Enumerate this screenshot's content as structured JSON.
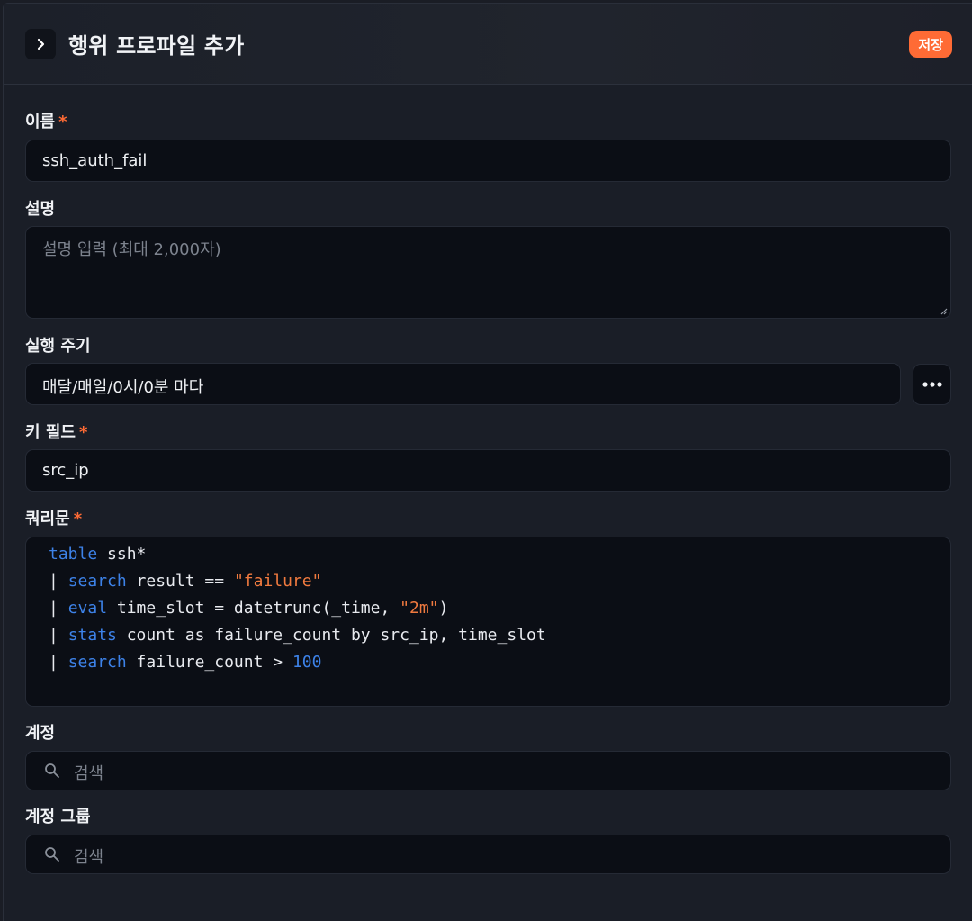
{
  "header": {
    "title": "행위 프로파일 추가",
    "save_label": "저장",
    "accent_color": "#ff6b35"
  },
  "form": {
    "name": {
      "label": "이름",
      "required_mark": "*",
      "value": "ssh_auth_fail"
    },
    "description": {
      "label": "설명",
      "placeholder": "설명 입력 (최대 2,000자)"
    },
    "schedule": {
      "label": "실행 주기",
      "value": "매달/매일/0시/0분 마다",
      "more_icon": "more-horizontal-icon"
    },
    "key_field": {
      "label": "키 필드",
      "required_mark": "*",
      "value": "src_ip"
    },
    "query": {
      "label": "쿼리문",
      "required_mark": "*",
      "lines": [
        [
          {
            "t": "table",
            "c": "kw"
          },
          {
            "t": " ssh*",
            "c": ""
          }
        ],
        [
          {
            "t": "| ",
            "c": ""
          },
          {
            "t": "search",
            "c": "kw"
          },
          {
            "t": " result == ",
            "c": ""
          },
          {
            "t": "\"failure\"",
            "c": "str"
          }
        ],
        [
          {
            "t": "| ",
            "c": ""
          },
          {
            "t": "eval",
            "c": "kw"
          },
          {
            "t": " time_slot = datetrunc(_time, ",
            "c": ""
          },
          {
            "t": "\"2m\"",
            "c": "str"
          },
          {
            "t": ")",
            "c": ""
          }
        ],
        [
          {
            "t": "| ",
            "c": ""
          },
          {
            "t": "stats",
            "c": "kw"
          },
          {
            "t": " count as failure_count by src_ip, time_slot",
            "c": ""
          }
        ],
        [
          {
            "t": "| ",
            "c": ""
          },
          {
            "t": "search",
            "c": "kw"
          },
          {
            "t": " failure_count > ",
            "c": ""
          },
          {
            "t": "100",
            "c": "num"
          }
        ]
      ]
    },
    "account": {
      "label": "계정",
      "placeholder": "검색"
    },
    "account_group": {
      "label": "계정 그룹",
      "placeholder": "검색"
    }
  }
}
